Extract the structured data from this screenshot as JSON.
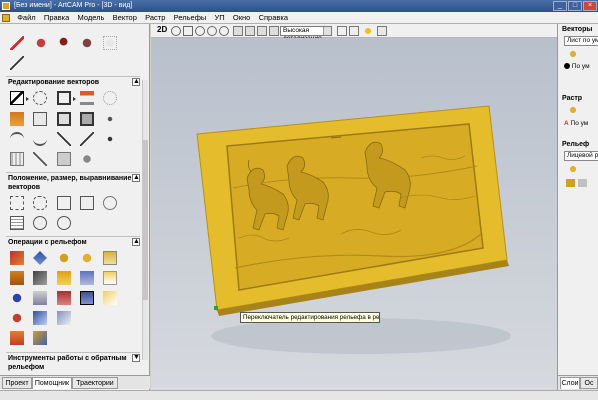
{
  "window": {
    "title": "[Без имени] - ArtCAM Pro - [3D - вид]",
    "controls": [
      "_",
      "□",
      "×"
    ]
  },
  "menubar": {
    "items": [
      "Файл",
      "Правка",
      "Модель",
      "Вектор",
      "Растр",
      "Рельефы",
      "УП",
      "Окно",
      "Справка"
    ]
  },
  "left_panel": {
    "sections": [
      {
        "title": "Редактирование векторов",
        "collapse": "▲"
      },
      {
        "title": "Положение, размер, выравнивание векторов",
        "collapse": "▲"
      },
      {
        "title": "Операции с рельефом",
        "collapse": "▲"
      },
      {
        "title": "Инструменты работы с обратным рельефом",
        "collapse": "▼"
      }
    ],
    "tabs": [
      "Проект",
      "Помощник",
      "Траектории"
    ]
  },
  "view_toolbar": {
    "mode_2d": "2D",
    "detail_level": "Высокая детализация"
  },
  "viewport": {
    "tooltip": "Переключатель редактирования рельефа в режим",
    "relief_color": "#e4bc2c",
    "background": "#c4cad3"
  },
  "right_panel": {
    "vectors": {
      "title": "Векторы",
      "layer_box": "Лист по ум",
      "layer_row": "По ум"
    },
    "raster": {
      "title": "Растр",
      "icon_label": "А",
      "row": "По ум"
    },
    "relief": {
      "title": "Рельеф",
      "layer_box": "Лицевой р"
    },
    "tabs": [
      "Слои",
      "Ос"
    ]
  },
  "colors": {
    "accent": "#2b4f86",
    "panel": "#f0f0f0",
    "relief": "#e4bc2c"
  }
}
